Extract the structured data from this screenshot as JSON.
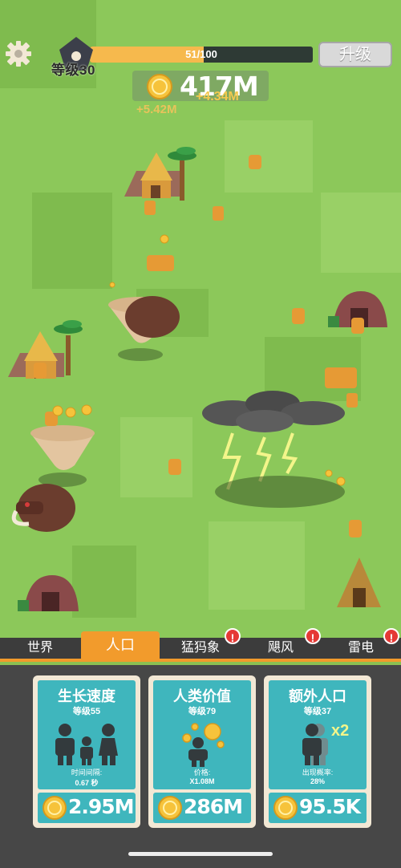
{
  "hud": {
    "level_label": "等级30",
    "xp_text": "51/100",
    "xp_progress": 0.51,
    "upgrade_label": "升级",
    "money": "417M",
    "gain_popup_1": "+4.34M",
    "gain_popup_2": "+5.42M"
  },
  "tabs": [
    {
      "label": "世界",
      "active": false,
      "badge": ""
    },
    {
      "label": "人口",
      "active": true,
      "badge": ""
    },
    {
      "label": "猛犸象",
      "active": false,
      "badge": "!"
    },
    {
      "label": "飓风",
      "active": false,
      "badge": "!"
    },
    {
      "label": "雷电",
      "active": false,
      "badge": "!"
    }
  ],
  "cards": [
    {
      "title": "生长速度",
      "level": "等级55",
      "stat_label": "时间间隔:",
      "stat_value": "0.67 秒",
      "price": "2.95M",
      "icon": "family-icon"
    },
    {
      "title": "人类价值",
      "level": "等级79",
      "stat_label": "价格:",
      "stat_value": "X1.08M",
      "price": "286M",
      "icon": "person-coins-icon"
    },
    {
      "title": "额外人口",
      "level": "等级37",
      "stat_label": "出现概率:",
      "stat_value": "28%",
      "price": "95.5K",
      "icon": "person-x2-icon",
      "multiplier": "x2"
    }
  ],
  "colors": {
    "grass": "#8cc85a",
    "accent_orange": "#f29b2c",
    "card_teal": "#3fb6bd",
    "coin_gold": "#f6c33b",
    "badge_red": "#e53935"
  }
}
